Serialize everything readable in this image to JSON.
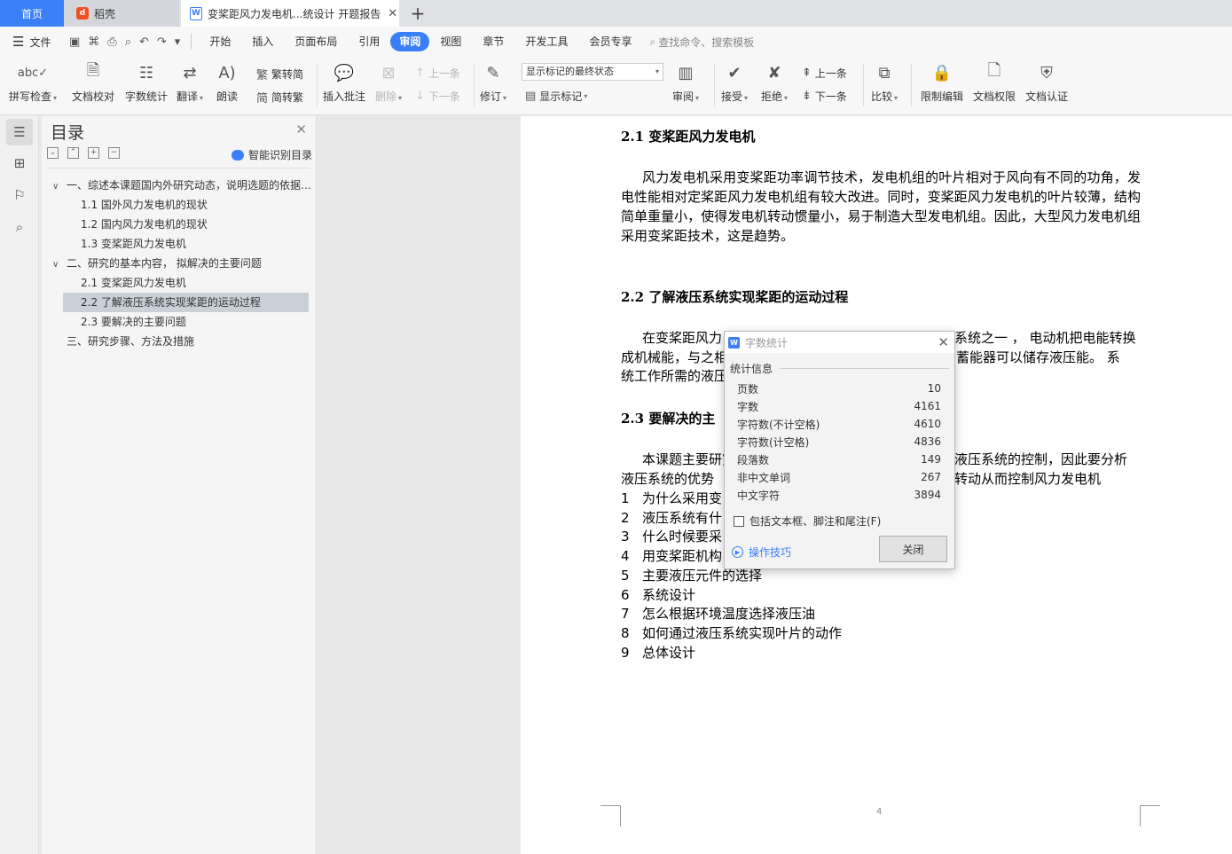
{
  "tabs": {
    "home": "首页",
    "daoke": "稻壳",
    "doc": "变桨距风力发电机...统设计 开题报告",
    "add": "+"
  },
  "menubar": {
    "file": "文件",
    "items": [
      "开始",
      "插入",
      "页面布局",
      "引用",
      "审阅",
      "视图",
      "章节",
      "开发工具",
      "会员专享"
    ],
    "search": "查找命令、搜索模板"
  },
  "ribbon": {
    "spell_check": "拼写检查",
    "doc_proof": "文档校对",
    "word_count": "字数统计",
    "translate": "翻译",
    "read_aloud": "朗读",
    "trad_to_simp": "繁转简",
    "simp_to_trad": "简转繁",
    "insert_comment": "插入批注",
    "delete": "删除",
    "prev_comment": "上一条",
    "next_comment": "下一条",
    "track_changes": "修订",
    "markup_select": "显示标记的最终状态",
    "show_markup": "显示标记",
    "review": "审阅",
    "accept": "接受",
    "reject": "拒绝",
    "prev_change": "上一条",
    "next_change": "下一条",
    "compare": "比较",
    "restrict_edit": "限制编辑",
    "doc_permission": "文档权限",
    "doc_auth": "文档认证"
  },
  "toc": {
    "title": "目录",
    "ai_label": "智能识别目录",
    "items": [
      "一、综述本课题国内外研究动态，说明选题的依据和意义",
      "1.1 国外风力发电机的现状",
      "1.2  国内风力发电机的现状",
      "1.3 变桨距风力发电机",
      "二、研究的基本内容， 拟解决的主要问题",
      "2.1 变桨距风力发电机",
      "2.2 了解液压系统实现桨距的运动过程",
      "2.3  要解决的主要问题",
      "三、研究步骤、方法及措施"
    ]
  },
  "document": {
    "h1": "2.1 变桨距风力发电机",
    "p1": "风力发电机采用变桨距功率调节技术，发电机组的叶片相对于风向有不同的功角，发电性能相对定桨距风力发电机组有较大改进。同时，变桨距风力发电机的叶片较薄，结构简单重量小，使得发电机转动惯量小，易于制造大型发电机组。因此，大型风力发电机组采用变桨距技术，这是趋势。",
    "h2": "2.2 了解液压系统实现桨距的运动过程",
    "p2_l1a": "在变桨距风力",
    "p2_l1b": "系统之一 ， 电动机把电能转换",
    "p2_l2a": "成机械能，与之相",
    "p2_l2b": "蓄能器可以储存液压能。 系",
    "p2_l3a": "统工作所需的液压",
    "h3": "2.3  要解决的主",
    "p3_l1a": "本课题主要研究",
    "p3_l1b": "液压系统的控制，因此要分析",
    "p3_l2a": "液压系统的优势",
    "p3_l2b": "转动从而控制风力发电机",
    "list": [
      {
        "n": "1",
        "t": "为什么采用变"
      },
      {
        "n": "2",
        "t": "液压系统有什"
      },
      {
        "n": "3",
        "t": "什么时候要采"
      },
      {
        "n": "4",
        "t": "用变桨距机构"
      },
      {
        "n": "5",
        "t": "主要液压元件的选择"
      },
      {
        "n": "6",
        "t": "系统设计"
      },
      {
        "n": "7",
        "t": "怎么根据环境温度选择液压油"
      },
      {
        "n": "8",
        "t": "如何通过液压系统实现叶片的动作"
      },
      {
        "n": "9",
        "t": "总体设计"
      }
    ],
    "page_number": "4"
  },
  "dialog": {
    "title": "字数统计",
    "section": "统计信息",
    "stats": [
      {
        "label": "页数",
        "value": "10"
      },
      {
        "label": "字数",
        "value": "4161"
      },
      {
        "label": "字符数(不计空格)",
        "value": "4610"
      },
      {
        "label": "字符数(计空格)",
        "value": "4836"
      },
      {
        "label": "段落数",
        "value": "149"
      },
      {
        "label": "非中文单词",
        "value": "267"
      },
      {
        "label": "中文字符",
        "value": "3894"
      }
    ],
    "checkbox_label": "包括文本框、脚注和尾注(F)",
    "tips": "操作技巧",
    "close_button": "关闭"
  },
  "colors": {
    "accent": "#3a7ff6"
  }
}
